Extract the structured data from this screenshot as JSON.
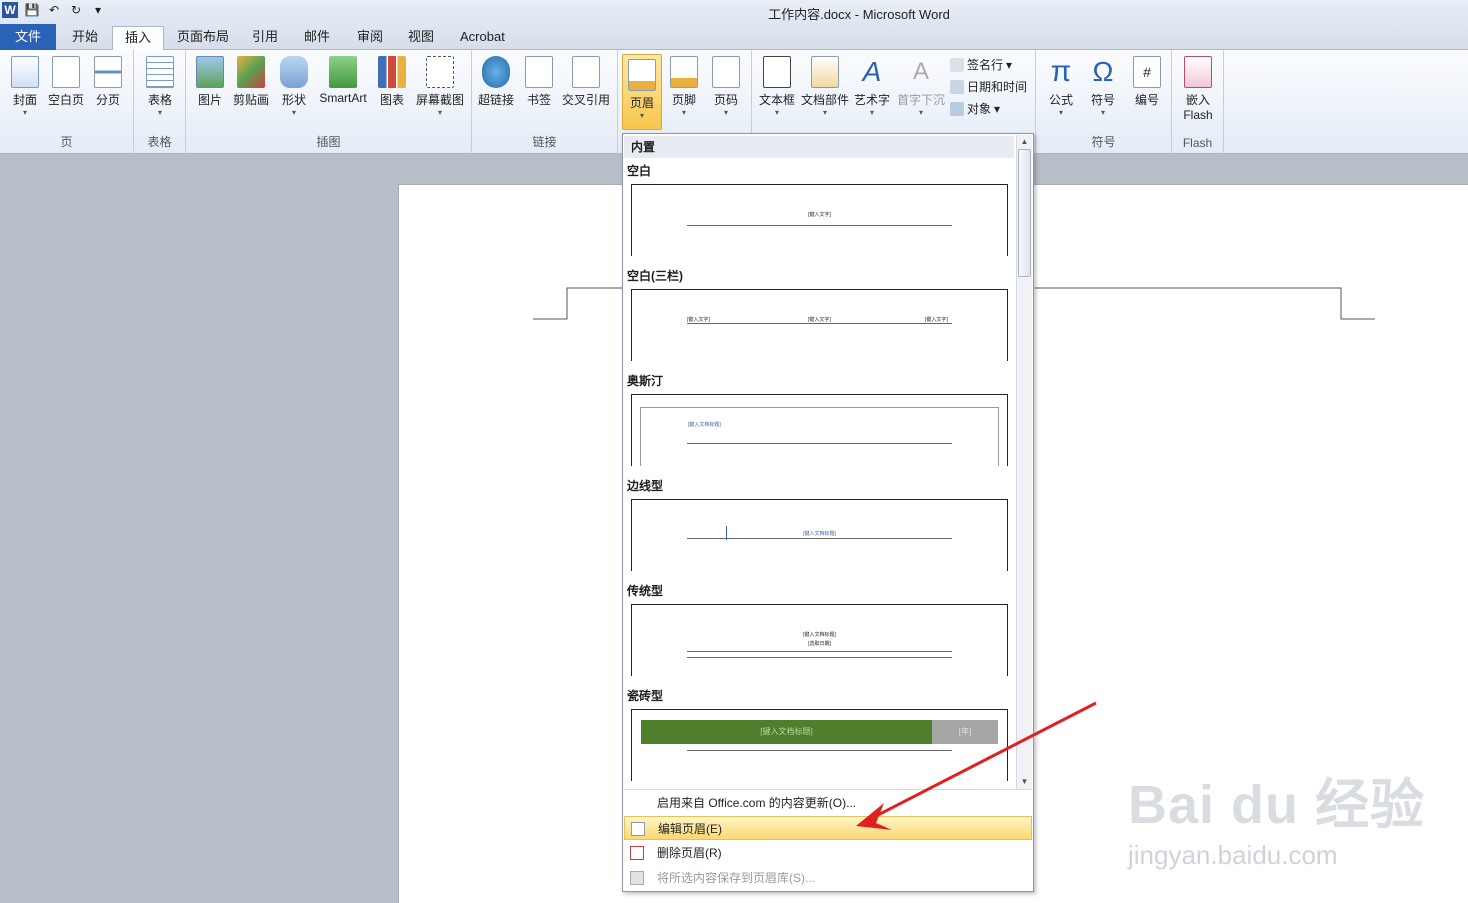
{
  "window": {
    "title": "工作内容.docx - Microsoft Word"
  },
  "qat": {
    "logo": "W"
  },
  "tabs": [
    {
      "label": "文件"
    },
    {
      "label": "开始"
    },
    {
      "label": "插入"
    },
    {
      "label": "页面布局"
    },
    {
      "label": "引用"
    },
    {
      "label": "邮件"
    },
    {
      "label": "审阅"
    },
    {
      "label": "视图"
    },
    {
      "label": "Acrobat"
    }
  ],
  "groups": {
    "page": "页",
    "table": "表格",
    "illustrations": "插图",
    "links": "链接",
    "symbols": "符号",
    "flash": "Flash"
  },
  "buttons": {
    "cover": "封面",
    "blank": "空白页",
    "break": "分页",
    "table": "表格",
    "picture": "图片",
    "clipart": "剪贴画",
    "shapes": "形状",
    "smartart": "SmartArt",
    "chart": "图表",
    "screenshot": "屏幕截图",
    "hyperlink": "超链接",
    "bookmark": "书签",
    "crossref": "交叉引用",
    "header": "页眉",
    "footer": "页脚",
    "pagenum": "页码",
    "textbox": "文本框",
    "quickparts": "文档部件",
    "wordart": "艺术字",
    "dropcap": "首字下沉",
    "signature": "签名行",
    "datetime": "日期和时间",
    "object": "对象",
    "equation": "公式",
    "symbol": "符号",
    "number": "编号",
    "flash1": "嵌入",
    "flash2": "Flash"
  },
  "menu": {
    "header": "内置",
    "items": [
      {
        "title": "空白",
        "placeholder": "[键入文字]"
      },
      {
        "title": "空白(三栏)",
        "placeholder": "[键入文字]"
      },
      {
        "title": "奥斯汀",
        "placeholder": "[键入文档标题]"
      },
      {
        "title": "边线型",
        "placeholder": "[键入文档标题]"
      },
      {
        "title": "传统型",
        "placeholder": "[键入文档标题]",
        "placeholder2": "[选取日期]"
      },
      {
        "title": "瓷砖型",
        "placeholder": "[键入文档标题]",
        "placeholder2": "[年]"
      }
    ],
    "commands": [
      {
        "label": "启用来自 Office.com 的内容更新(O)..."
      },
      {
        "label": "编辑页眉(E)"
      },
      {
        "label": "删除页眉(R)"
      },
      {
        "label": "将所选内容保存到页眉库(S)..."
      }
    ]
  },
  "watermark": {
    "brand": "Bai du 经验",
    "url": "jingyan.baidu.com"
  },
  "colors": {
    "accent": "#2a62b8",
    "tile": "#4f7f2b",
    "highlight": "#fbd871",
    "arrow": "#e02020"
  }
}
